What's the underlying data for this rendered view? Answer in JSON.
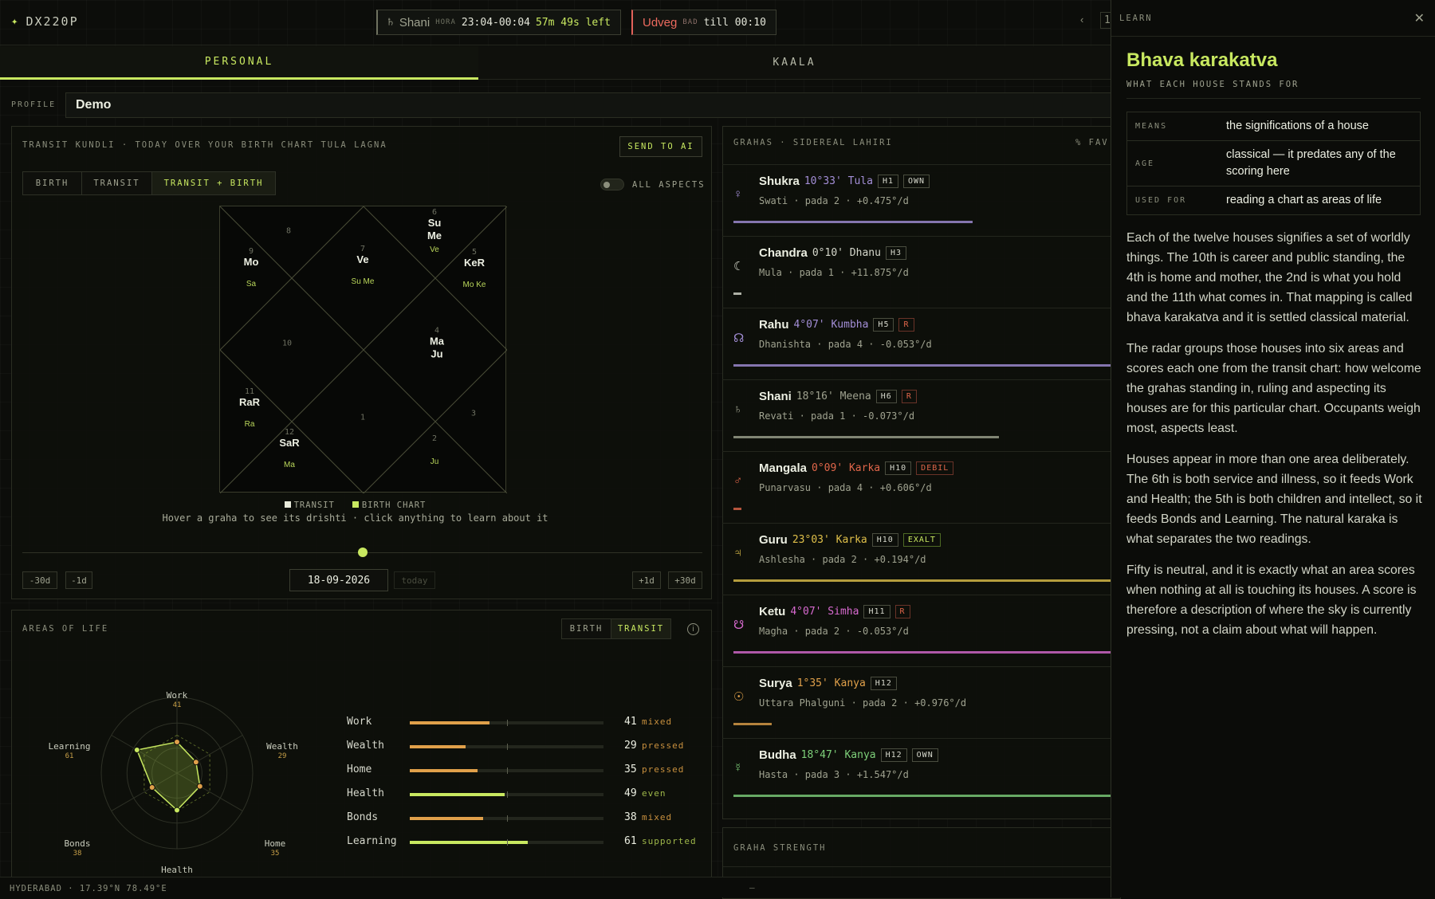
{
  "brand": {
    "logo": "✦",
    "name": "DX220P"
  },
  "hora": {
    "icon": "♄",
    "planet": "Shani",
    "tag": "HORA",
    "time": "23:04-00:04",
    "remaining": "57m 49s left"
  },
  "choghadiya": {
    "name": "Udveg",
    "tag": "BAD",
    "until": "till 00:10"
  },
  "nav": {
    "prev": "‹",
    "next_partial": "1"
  },
  "main_tabs": [
    {
      "label": "PERSONAL",
      "active": true
    },
    {
      "label": "KAALA",
      "active": false
    }
  ],
  "profile": {
    "label": "PROFILE",
    "value": "Demo"
  },
  "kundli": {
    "title": "TRANSIT KUNDLI · TODAY OVER YOUR BIRTH CHART TULA LAGNA",
    "send_button": "SEND TO AI",
    "modes": [
      {
        "label": "BIRTH"
      },
      {
        "label": "TRANSIT"
      },
      {
        "label": "TRANSIT + BIRTH",
        "active": true
      }
    ],
    "toggle_label": "ALL ASPECTS",
    "houses": [
      {
        "n": "8",
        "top": "",
        "bottom": ""
      },
      {
        "n": "9",
        "top": "Mo",
        "bottom": "Sa"
      },
      {
        "n": "7",
        "top": "Ve",
        "bottom": "Su Me"
      },
      {
        "n": "6",
        "top": "Su\nMe",
        "bottom": "Ve"
      },
      {
        "n": "5",
        "top": "KeR",
        "bottom": "Mo Ke"
      },
      {
        "n": "10",
        "top": "",
        "bottom": ""
      },
      {
        "n": "4",
        "top": "Ma\nJu",
        "bottom": ""
      },
      {
        "n": "11",
        "top": "RaR",
        "bottom": "Ra"
      },
      {
        "n": "1",
        "top": "",
        "bottom": ""
      },
      {
        "n": "3",
        "top": "",
        "bottom": ""
      },
      {
        "n": "12",
        "top": "SaR",
        "bottom": "Ma"
      },
      {
        "n": "2",
        "top": "",
        "bottom": "Ju"
      }
    ],
    "legend": [
      {
        "label": "TRANSIT",
        "color": "#e8eadb"
      },
      {
        "label": "BIRTH CHART",
        "color": "#c8e860"
      }
    ],
    "hint": "Hover a graha to see its drishti · click anything to learn about it",
    "nav_buttons": {
      "minus30": "-30d",
      "minus1": "-1d",
      "plus1": "+1d",
      "plus30": "+30d"
    },
    "date": "18-09-2026",
    "today": "today"
  },
  "areas": {
    "title": "AREAS OF LIFE",
    "modes": [
      {
        "label": "BIRTH"
      },
      {
        "label": "TRANSIT",
        "active": true
      }
    ],
    "info": "i",
    "items": [
      {
        "name": "Work",
        "score": "41",
        "status": "mixed",
        "color": "#e0a04a"
      },
      {
        "name": "Wealth",
        "score": "29",
        "status": "pressed",
        "color": "#e0a04a"
      },
      {
        "name": "Home",
        "score": "35",
        "status": "pressed",
        "color": "#e0a04a"
      },
      {
        "name": "Health",
        "score": "49",
        "status": "even",
        "color": "#c8e860"
      },
      {
        "name": "Bonds",
        "score": "38",
        "status": "mixed",
        "color": "#e0a04a"
      },
      {
        "name": "Learning",
        "score": "61",
        "status": "supported",
        "color": "#c8e860"
      }
    ]
  },
  "grahas": {
    "title": "GRAHAS · SIDEREAL LAHIRI",
    "right_label": "% FAV",
    "items": [
      {
        "icon": "♀",
        "name": "Shukra",
        "degree": "10°33'",
        "sign": "Tula",
        "house": "H1",
        "tag": "OWN",
        "nakshatra": "Swati · pada 2 · +0.475°/d",
        "color": "#a48fd8",
        "tagcolor": "#d6d8cc",
        "bar": 0.63
      },
      {
        "icon": "☾",
        "name": "Chandra",
        "degree": "0°10'",
        "sign": "Dhanu",
        "house": "H3",
        "tag": "",
        "nakshatra": "Mula · pada 1 · +11.875°/d",
        "color": "#d6d8cc",
        "tagcolor": "",
        "bar": 0.02
      },
      {
        "icon": "☊",
        "name": "Rahu",
        "degree": "4°07'",
        "sign": "Kumbha",
        "house": "H5",
        "tag": "R",
        "nakshatra": "Dhanishta · pada 4 · -0.053°/d",
        "color": "#a48fd8",
        "tagcolor": "#e0664a",
        "bar": 1.0
      },
      {
        "icon": "♄",
        "name": "Shani",
        "degree": "18°16'",
        "sign": "Meena",
        "house": "H6",
        "tag": "R",
        "nakshatra": "Revati · pada 1 · -0.073°/d",
        "color": "#9fa28f",
        "tagcolor": "#e0664a",
        "bar": 0.7
      },
      {
        "icon": "♂",
        "name": "Mangala",
        "degree": "0°09'",
        "sign": "Karka",
        "house": "H10",
        "tag": "DEBIL",
        "nakshatra": "Punarvasu · pada 4 · +0.606°/d",
        "color": "#e0664a",
        "tagcolor": "#e0664a",
        "bar": 0.02
      },
      {
        "icon": "♃",
        "name": "Guru",
        "degree": "23°03'",
        "sign": "Karka",
        "house": "H10",
        "tag": "EXALT",
        "nakshatra": "Ashlesha · pada 2 · +0.194°/d",
        "color": "#e0c04a",
        "tagcolor": "#c8e860",
        "bar": 1.0
      },
      {
        "icon": "☋",
        "name": "Ketu",
        "degree": "4°07'",
        "sign": "Simha",
        "house": "H11",
        "tag": "R",
        "nakshatra": "Magha · pada 2 · -0.053°/d",
        "color": "#d86ad0",
        "tagcolor": "#e0664a",
        "bar": 1.0
      },
      {
        "icon": "☉",
        "name": "Surya",
        "degree": "1°35'",
        "sign": "Kanya",
        "house": "H12",
        "tag": "",
        "nakshatra": "Uttara Phalguni · pada 2 · +0.976°/d",
        "color": "#e0a04a",
        "tagcolor": "",
        "bar": 0.1
      },
      {
        "icon": "☿",
        "name": "Budha",
        "degree": "18°47'",
        "sign": "Kanya",
        "house": "H12",
        "tag": "OWN",
        "nakshatra": "Hasta · pada 3 · +1.547°/d",
        "color": "#7ed07a",
        "tagcolor": "#d6d8cc",
        "bar": 1.0
      }
    ]
  },
  "strength": {
    "title": "GRAHA STRENGTH"
  },
  "learn": {
    "header": "LEARN",
    "close": "✕",
    "title": "Bhava karakatva",
    "subtitle": "WHAT EACH HOUSE STANDS FOR",
    "facts": [
      {
        "key": "MEANS",
        "value": "the significations of a house"
      },
      {
        "key": "AGE",
        "value": "classical — it predates any of the scoring here"
      },
      {
        "key": "USED FOR",
        "value": "reading a chart as areas of life"
      }
    ],
    "paragraphs": [
      "Each of the twelve houses signifies a set of worldly things. The 10th is career and public standing, the 4th is home and mother, the 2nd is what you hold and the 11th what comes in. That mapping is called bhava karakatva and it is settled classical material.",
      "The radar groups those houses into six areas and scores each one from the transit chart: how welcome the grahas standing in, ruling and aspecting its houses are for this particular chart. Occupants weigh most, aspects least.",
      "Houses appear in more than one area deliberately. The 6th is both service and illness, so it feeds Work and Health; the 5th is both children and intellect, so it feeds Bonds and Learning. The natural karaka is what separates the two readings.",
      "Fifty is neutral, and it is exactly what an area scores when nothing at all is touching its houses. A score is therefore a description of where the sky is currently pressing, not a claim about what will happen."
    ]
  },
  "footer": {
    "location": "HYDERABAD · 17.39°N 78.49°E",
    "dash": "—"
  }
}
